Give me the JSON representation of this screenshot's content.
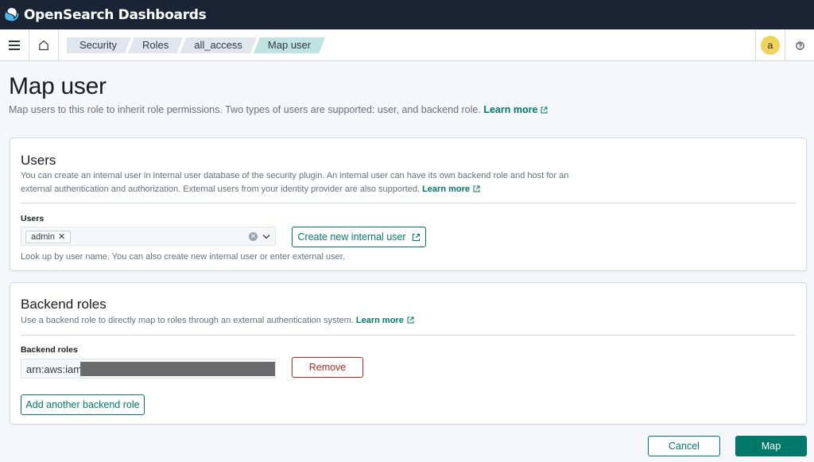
{
  "app": {
    "title": "OpenSearch Dashboards"
  },
  "breadcrumbs": [
    "Security",
    "Roles",
    "all_access",
    "Map user"
  ],
  "user": {
    "avatar_initial": "a"
  },
  "page": {
    "title": "Map user",
    "description": "Map users to this role to inherit role permissions. Two types of users are supported: user, and backend role.",
    "learn_more": "Learn more"
  },
  "users_panel": {
    "title": "Users",
    "description": "You can create an internal user in internal user database of the security plugin. An internal user can have its own backend role and host for an external authentication and authorization. External users from your identity provider are also supported.",
    "learn_more": "Learn more",
    "field_label": "Users",
    "selected": [
      "admin"
    ],
    "create_button": "Create new internal user",
    "help_text": "Look up by user name. You can also create new internal user or enter external user."
  },
  "backend_panel": {
    "title": "Backend roles",
    "description": "Use a backend role to directly map to roles through an external authentication system.",
    "learn_more": "Learn more",
    "field_label": "Backend roles",
    "role_value": "arn:aws:iam:",
    "remove_button": "Remove",
    "add_button": "Add another backend role"
  },
  "footer": {
    "cancel": "Cancel",
    "map": "Map"
  },
  "colors": {
    "accent": "#00796b",
    "danger": "#bd271e",
    "header": "#1b2434"
  }
}
